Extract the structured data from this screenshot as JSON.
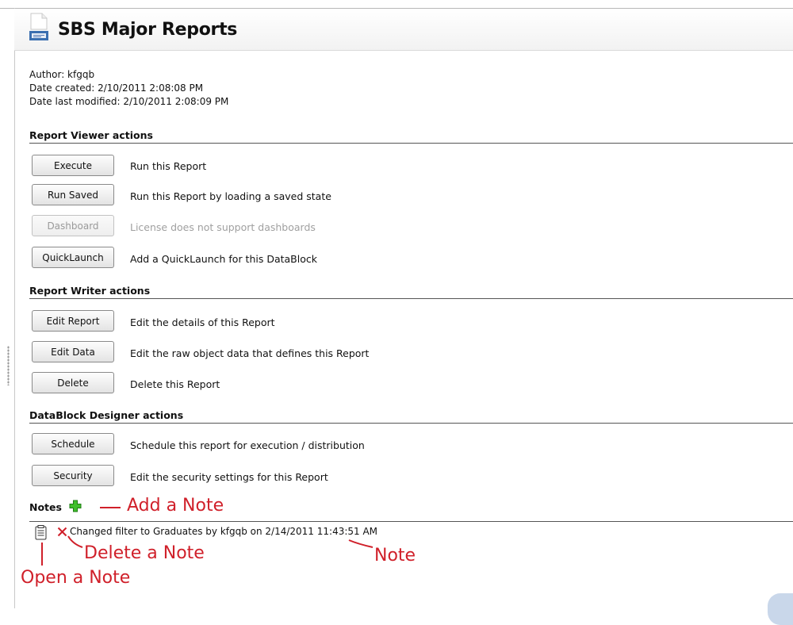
{
  "title": "SBS Major Reports",
  "meta": {
    "author": "Author: kfgqb",
    "created": "Date created: 2/10/2011 2:08:08 PM",
    "modified": "Date last modified: 2/10/2011 2:08:09 PM"
  },
  "sections": {
    "viewer": {
      "title": "Report Viewer actions",
      "actions": [
        {
          "label": "Execute",
          "desc": "Run this Report"
        },
        {
          "label": "Run Saved",
          "desc": "Run this Report by loading a saved state"
        },
        {
          "label": "Dashboard",
          "desc": "License does not support dashboards",
          "disabled": true
        },
        {
          "label": "QuickLaunch",
          "desc": "Add a QuickLaunch for this DataBlock"
        }
      ]
    },
    "writer": {
      "title": "Report Writer actions",
      "actions": [
        {
          "label": "Edit Report",
          "desc": "Edit the details of this Report"
        },
        {
          "label": "Edit Data",
          "desc": "Edit the raw object data that defines this Report"
        },
        {
          "label": "Delete",
          "desc": "Delete this Report"
        }
      ]
    },
    "designer": {
      "title": "DataBlock Designer actions",
      "actions": [
        {
          "label": "Schedule",
          "desc": "Schedule this report for execution / distribution"
        },
        {
          "label": "Security",
          "desc": "Edit the security settings for this Report"
        }
      ]
    }
  },
  "notes": {
    "title": "Notes",
    "items": [
      {
        "text": "Changed filter to Graduates by kfgqb on 2/14/2011 11:43:51 AM"
      }
    ]
  },
  "annotations": {
    "add_note": "Add a Note",
    "delete_note": "Delete a Note",
    "note": "Note",
    "open_note": "Open a Note"
  },
  "icons": {
    "doc": "document-icon",
    "add": "plus-icon",
    "open": "notepad-icon",
    "delete": "close-icon"
  },
  "colors": {
    "annotation": "#d0202a",
    "add_icon": "#2fa81e",
    "delete_icon": "#d0202a",
    "disabled_text": "#a0a0a0"
  }
}
